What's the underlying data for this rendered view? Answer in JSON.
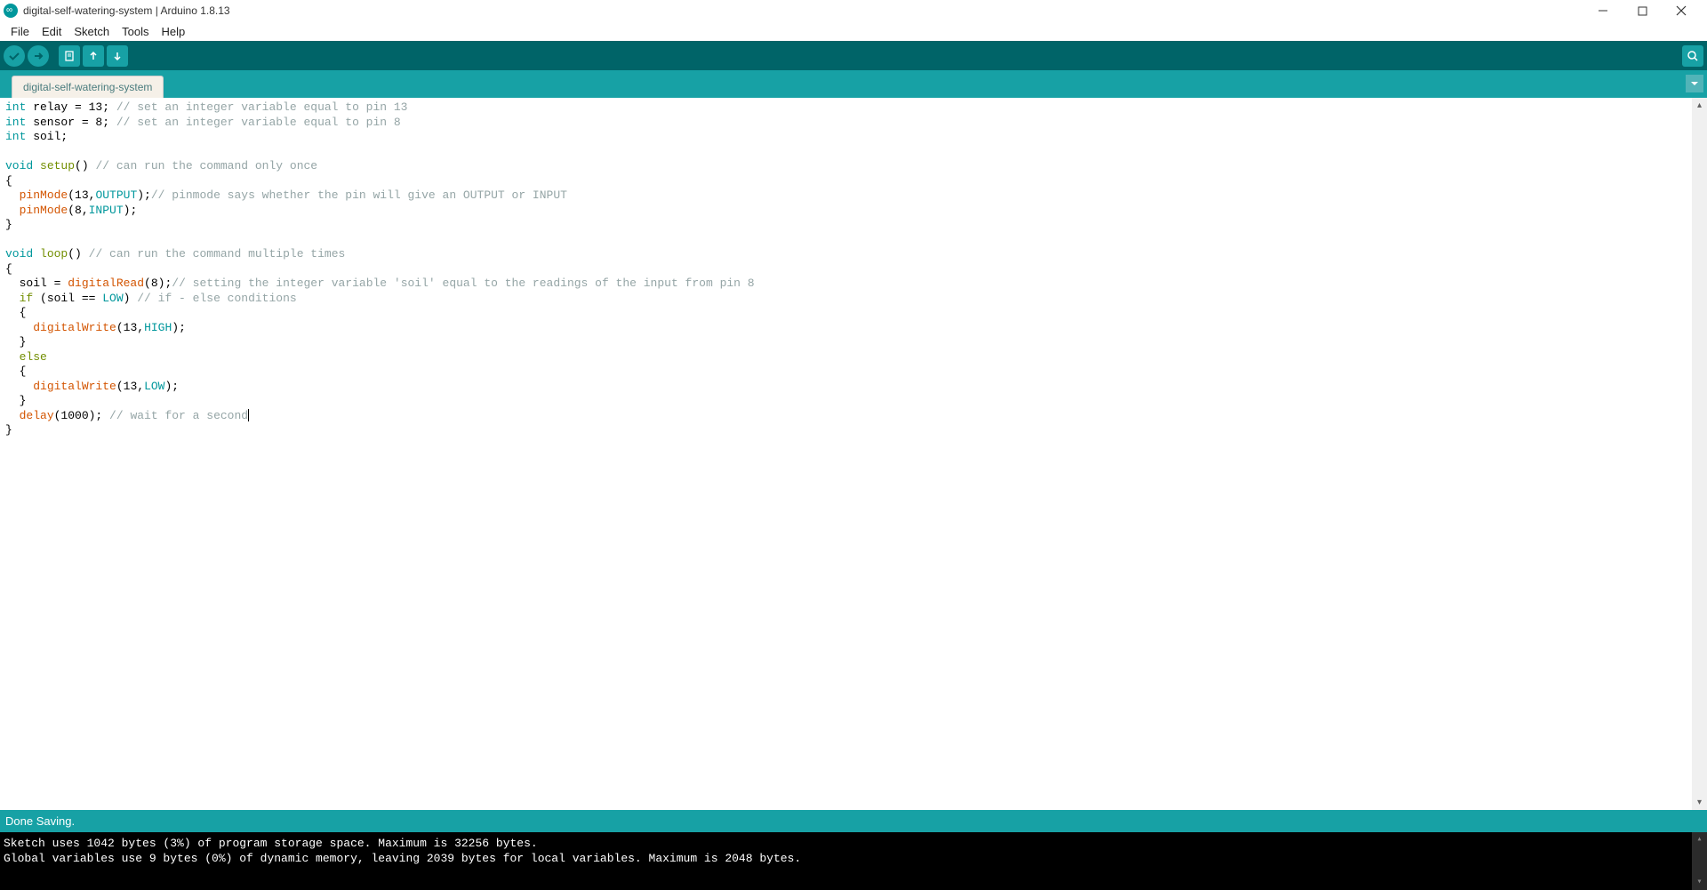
{
  "window": {
    "title": "digital-self-watering-system | Arduino 1.8.13"
  },
  "menu": {
    "file": "File",
    "edit": "Edit",
    "sketch": "Sketch",
    "tools": "Tools",
    "help": "Help"
  },
  "tabs": {
    "main": "digital-self-watering-system"
  },
  "code": {
    "l1a": "int",
    "l1b": " relay = 13; ",
    "l1c": "// set an integer variable equal to pin 13",
    "l2a": "int",
    "l2b": " sensor = 8; ",
    "l2c": "// set an integer variable equal to pin 8",
    "l3a": "int",
    "l3b": " soil;",
    "l5a": "void",
    "l5b": " ",
    "l5c": "setup",
    "l5d": "() ",
    "l5e": "// can run the command only once",
    "l6": "{",
    "l7a": "  ",
    "l7b": "pinMode",
    "l7c": "(13,",
    "l7d": "OUTPUT",
    "l7e": ");",
    "l7f": "// pinmode says whether the pin will give an OUTPUT or INPUT",
    "l8a": "  ",
    "l8b": "pinMode",
    "l8c": "(8,",
    "l8d": "INPUT",
    "l8e": ");",
    "l9": "}",
    "l11a": "void",
    "l11b": " ",
    "l11c": "loop",
    "l11d": "() ",
    "l11e": "// can run the command multiple times",
    "l12": "{",
    "l13a": "  soil = ",
    "l13b": "digitalRead",
    "l13c": "(8);",
    "l13d": "// setting the integer variable 'soil' equal to the readings of the input from pin 8",
    "l14a": "  ",
    "l14b": "if",
    "l14c": " (soil == ",
    "l14d": "LOW",
    "l14e": ") ",
    "l14f": "// if - else conditions",
    "l15": "  {",
    "l16a": "    ",
    "l16b": "digitalWrite",
    "l16c": "(13,",
    "l16d": "HIGH",
    "l16e": ");",
    "l17": "  }",
    "l18a": "  ",
    "l18b": "else",
    "l19": "  {",
    "l20a": "    ",
    "l20b": "digitalWrite",
    "l20c": "(13,",
    "l20d": "LOW",
    "l20e": ");",
    "l21": "  }",
    "l22a": "  ",
    "l22b": "delay",
    "l22c": "(1000); ",
    "l22d": "// wait for a second",
    "l23": "}"
  },
  "status": {
    "message": "Done Saving."
  },
  "console": {
    "line1": "Sketch uses 1042 bytes (3%) of program storage space. Maximum is 32256 bytes.",
    "line2": "Global variables use 9 bytes (0%) of dynamic memory, leaving 2039 bytes for local variables. Maximum is 2048 bytes."
  }
}
